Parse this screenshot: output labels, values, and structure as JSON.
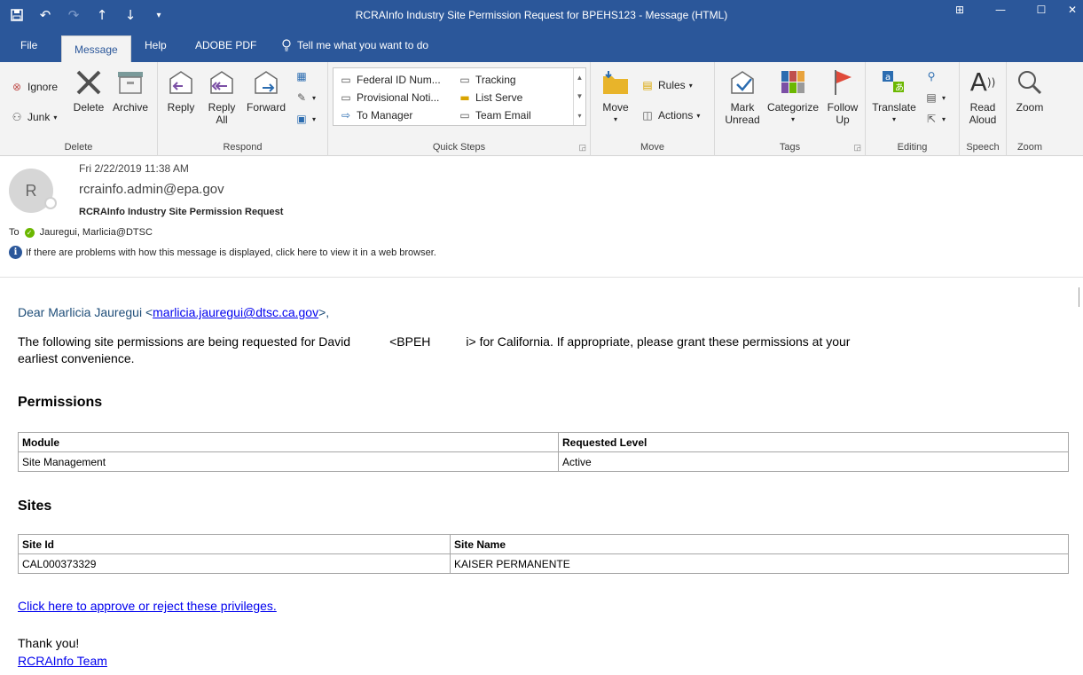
{
  "window": {
    "title": "RCRAInfo Industry Site Permission Request for BPEHS123  -  Message (HTML)"
  },
  "quick_access": {
    "save_icon": "save-icon",
    "undo_icon": "undo-icon",
    "redo_icon": "redo-icon",
    "up_icon": "up-arrow-icon",
    "down_icon": "down-arrow-icon"
  },
  "tabs": [
    {
      "label": "File"
    },
    {
      "label": "Message"
    },
    {
      "label": "Help"
    },
    {
      "label": "ADOBE PDF"
    }
  ],
  "tell_me": "Tell me what you want to do",
  "ribbon": {
    "delete": {
      "label": "Delete",
      "ignore": "Ignore",
      "junk": "Junk",
      "delete_btn": "Delete",
      "archive": "Archive"
    },
    "respond": {
      "label": "Respond",
      "reply": "Reply",
      "reply_all_1": "Reply",
      "reply_all_2": "All",
      "forward": "Forward"
    },
    "quick_steps": {
      "label": "Quick Steps",
      "items": [
        "Federal ID Num...",
        "Tracking",
        "Provisional Noti...",
        "List Serve",
        "To Manager",
        "Team Email"
      ]
    },
    "move": {
      "label": "Move",
      "move": "Move",
      "rules": "Rules",
      "actions": "Actions"
    },
    "tags": {
      "label": "Tags",
      "mark_unread_1": "Mark",
      "mark_unread_2": "Unread",
      "categorize": "Categorize",
      "follow_up_1": "Follow",
      "follow_up_2": "Up"
    },
    "editing": {
      "label": "Editing",
      "translate": "Translate"
    },
    "speech": {
      "label": "Speech",
      "read_aloud_1": "Read",
      "read_aloud_2": "Aloud"
    },
    "zoom": {
      "label": "Zoom",
      "zoom": "Zoom"
    }
  },
  "header": {
    "avatar_initial": "R",
    "date": "Fri 2/22/2019 11:38 AM",
    "from": "rcrainfo.admin@epa.gov",
    "subject": "RCRAInfo Industry Site Permission Request",
    "to_label": "To",
    "to_value": "Jauregui, Marlicia@DTSC",
    "info": "If there are problems with how this message is displayed, click here to view it in a web browser."
  },
  "body": {
    "greeting_prefix": "Dear Marlicia Jauregui <",
    "greeting_email": "marlicia.jauregui@dtsc.ca.gov",
    "greeting_suffix": ">,",
    "para_1": "The following site permissions are being requested for David",
    "para_2": "<BPEH",
    "para_3": "i> for California. If appropriate, please grant these permissions at your",
    "para_4": "earliest convenience.",
    "permissions_title": "Permissions",
    "permissions_headers": [
      "Module",
      "Requested Level"
    ],
    "permissions_rows": [
      [
        "Site Management",
        "Active"
      ]
    ],
    "sites_title": "Sites",
    "sites_headers": [
      "Site Id",
      "Site Name"
    ],
    "sites_rows": [
      [
        "CAL000373329",
        "KAISER PERMANENTE"
      ]
    ],
    "approve_link": "Click here to approve or reject these privileges.",
    "thanks": "Thank you!",
    "team_link": "RCRAInfo Team"
  }
}
